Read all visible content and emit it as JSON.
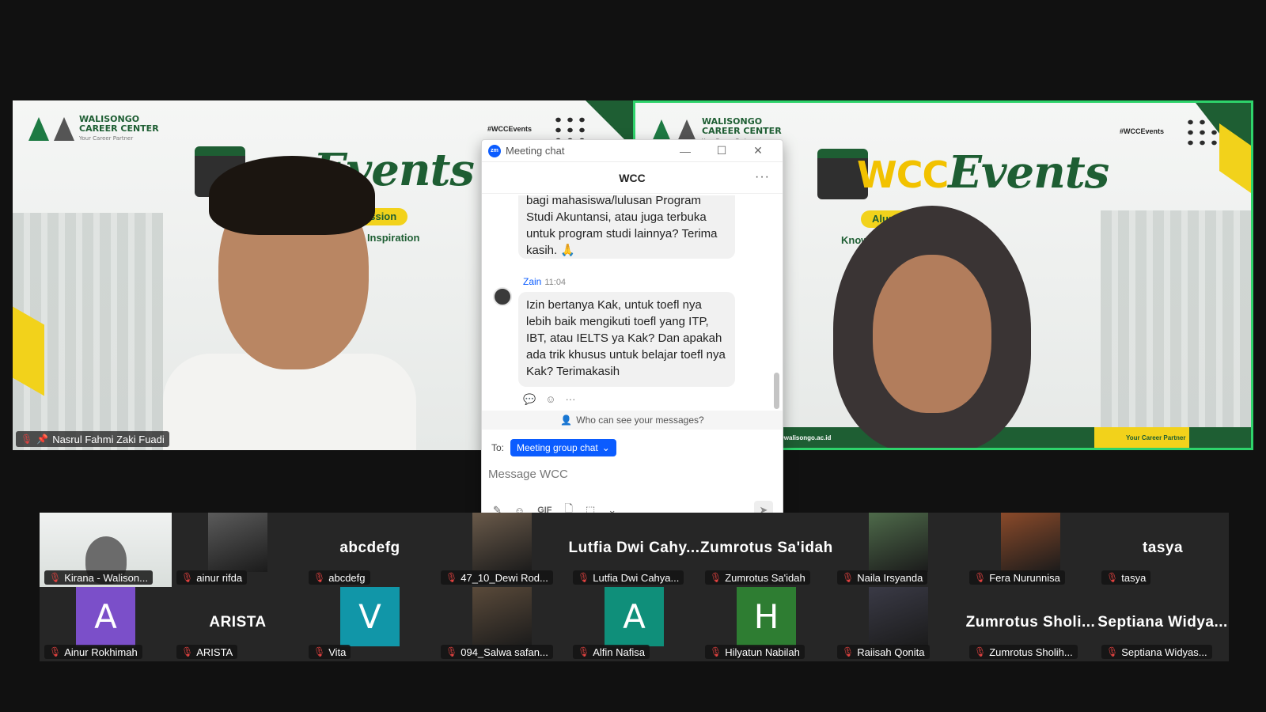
{
  "main_tiles": {
    "left": {
      "name": "Nasrul Fahmi Zaki Fuadi",
      "muted": true,
      "pinned": true
    },
    "right": {
      "active_speaker": true
    }
  },
  "banner": {
    "org_line1": "WALISONGO",
    "org_line2": "CAREER CENTER",
    "org_tag": "Your Career Partner",
    "hashtag": "#WCCEvents",
    "events_prefix": "WCC",
    "events_word": "Events",
    "session_pill": "Alumni Session",
    "tagline": "Knowledge & Inspiration",
    "footer_site": "@walisongo.ac.id",
    "footer_right": "Your Career Partner"
  },
  "chat": {
    "window_title": "Meeting chat",
    "logo": "zm",
    "header": "WCC",
    "messages": [
      {
        "text": "bagi mahasiswa/lulusan Program Studi Akuntansi, atau juga terbuka untuk program studi lainnya? Terima kasih. 🙏"
      },
      {
        "sender": "Zain",
        "time": "11:04",
        "text": "Izin bertanya Kak, untuk toefl nya lebih baik mengikuti toefl yang ITP, IBT, atau IELTS ya Kak? Dan apakah ada trik khusus untuk belajar toefl nya Kak? Terimakasih"
      }
    ],
    "privacy_note": "Who can see your messages?",
    "to_label": "To:",
    "to_value": "Meeting group chat",
    "input_placeholder": "Message WCC",
    "gif_label": "GIF"
  },
  "gallery": [
    {
      "label": "Kirana - Walison...",
      "kind": "banner"
    },
    {
      "label": "ainur rifda",
      "kind": "photo",
      "color": "#5b5b5b"
    },
    {
      "label": "abcdefg",
      "kind": "name",
      "big": "abcdefg"
    },
    {
      "label": "47_10_Dewi Rod...",
      "kind": "photo",
      "color": "#6a5a4a"
    },
    {
      "label": "Lutfia Dwi Cahya...",
      "kind": "name",
      "big": "Lutfia Dwi Cahy..."
    },
    {
      "label": "Zumrotus Sa'idah",
      "kind": "name",
      "big": "Zumrotus Sa'idah"
    },
    {
      "label": "Naila Irsyanda",
      "kind": "photo",
      "color": "#4e6a4a"
    },
    {
      "label": "Fera Nurunnisa",
      "kind": "photo",
      "color": "#8a4a2a"
    },
    {
      "label": "tasya",
      "kind": "name",
      "big": "tasya"
    },
    {
      "label": "Ainur Rokhimah",
      "kind": "avatar",
      "letter": "A",
      "color": "#7b4fc9"
    },
    {
      "label": "ARISTA",
      "kind": "name",
      "big": "ARISTA"
    },
    {
      "label": "Vita",
      "kind": "avatar",
      "letter": "V",
      "color": "#1196a8"
    },
    {
      "label": "094_Salwa safan...",
      "kind": "photo",
      "color": "#5a4a3a"
    },
    {
      "label": "Alfin Nafisa",
      "kind": "avatar",
      "letter": "A",
      "color": "#0f8f7a"
    },
    {
      "label": "Hilyatun Nabilah",
      "kind": "avatar",
      "letter": "H",
      "color": "#2e7d32"
    },
    {
      "label": "Raiisah Qonita",
      "kind": "photo",
      "color": "#3a3a46"
    },
    {
      "label": "Zumrotus Sholih...",
      "kind": "name",
      "big": "Zumrotus Sholi..."
    },
    {
      "label": "Septiana Widyas...",
      "kind": "name",
      "big": "Septiana Widya..."
    }
  ],
  "colors": {
    "accent_blue": "#0b5cff",
    "active_speaker_border": "#2ed36b",
    "muted_red": "#e0413f",
    "brand_green": "#1e5e33",
    "brand_yellow": "#f2d21b"
  }
}
